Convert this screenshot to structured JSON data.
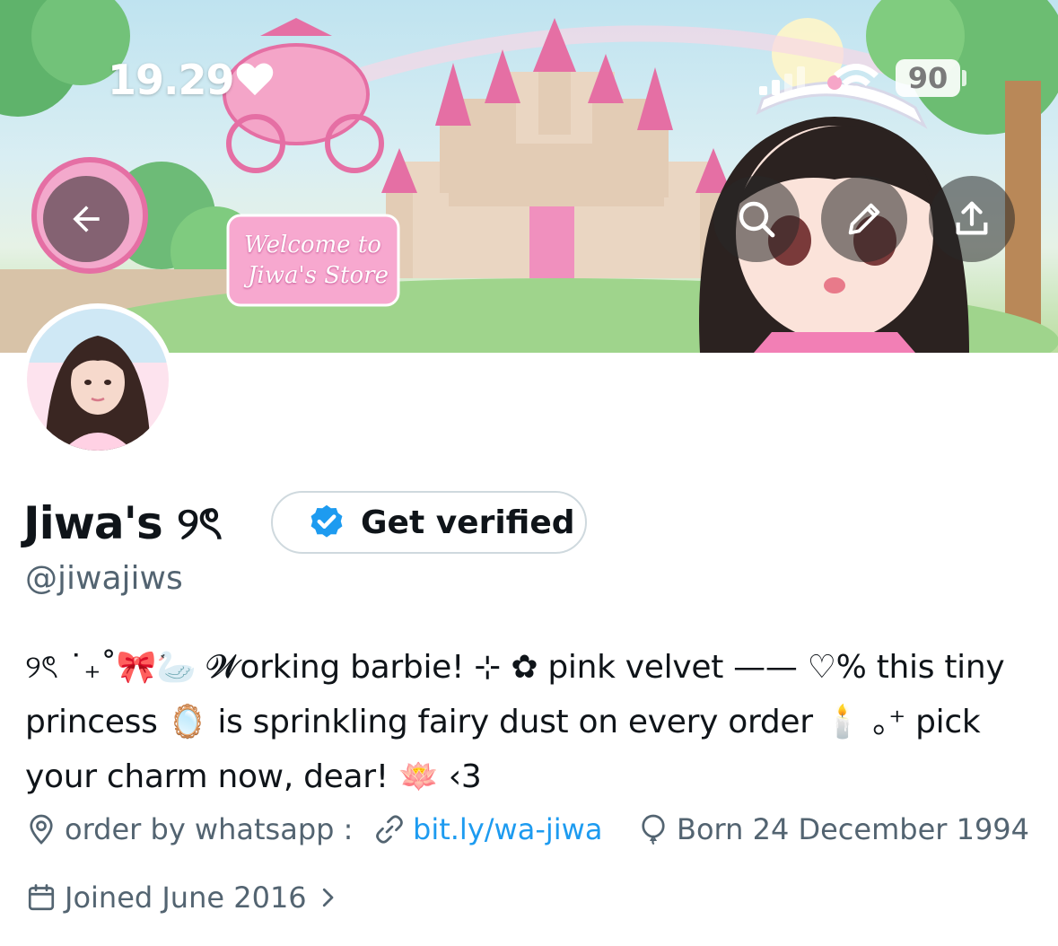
{
  "status_bar": {
    "time": "19.29",
    "battery": "90"
  },
  "banner": {
    "sign_line1": "Welcome to",
    "sign_line2": "Jiwa's Store"
  },
  "profile": {
    "display_name": "Jiwa's ୨ৎ",
    "verify_label": "Get verified",
    "handle": "@jiwajiws",
    "bio_line1": "୨ৎ ˙₊˚🎀🦢 𝓦orking barbie! ⊹ ✿ pink velvet —— ♡% this tiny",
    "bio_line2": "princess 🪞 is sprinkling fairy dust on every order 🕯️ ｡⁺ pick",
    "bio_line3": "your charm now, dear! 🪷 ‹3",
    "location": "order by whatsapp :",
    "link": "bit.ly/wa-jiwa",
    "born": "Born 24 December 1994",
    "joined": "Joined June 2016"
  },
  "colors": {
    "link": "#1d9bf0",
    "verified_badge": "#1d9bf0",
    "secondary_text": "#536471"
  },
  "icons": [
    "back-arrow-icon",
    "search-icon",
    "pencil-icon",
    "share-icon",
    "verified-badge-icon",
    "location-pin-icon",
    "link-icon",
    "balloon-icon",
    "calendar-icon",
    "chevron-right-icon",
    "heart-icon",
    "signal-icon",
    "wifi-icon"
  ]
}
